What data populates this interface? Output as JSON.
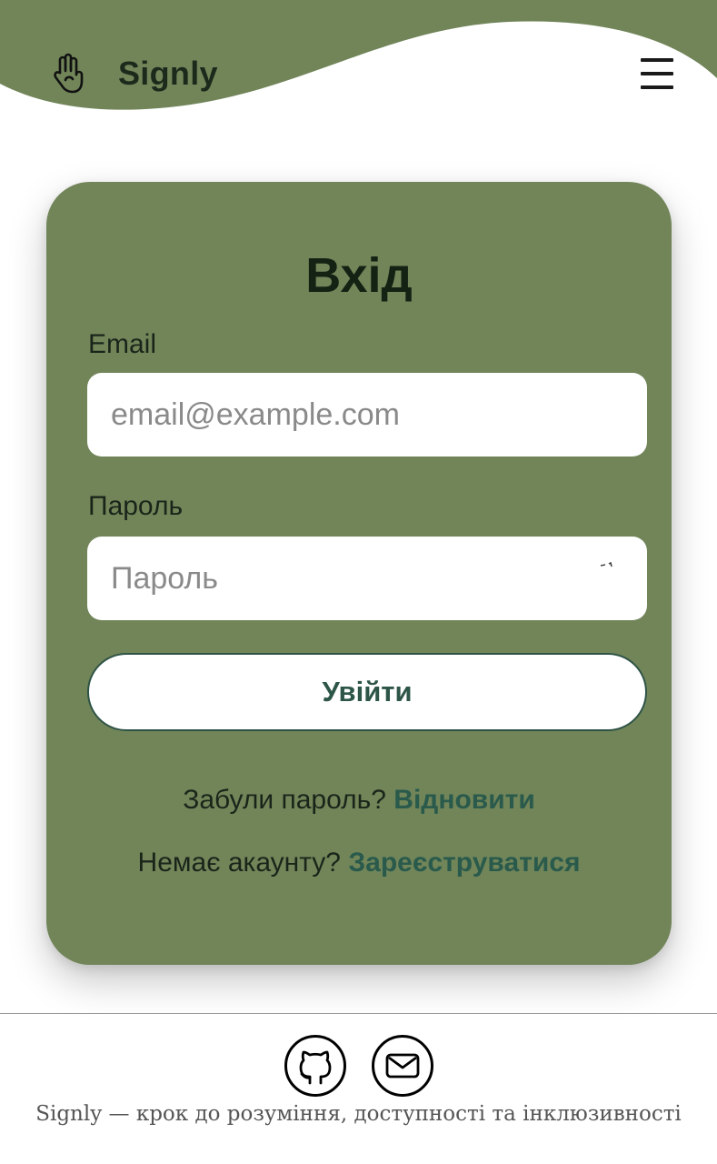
{
  "header": {
    "brand": "Signly",
    "accent_color": "#718559"
  },
  "login": {
    "title": "Вхід",
    "email_label": "Email",
    "email_placeholder": "email@example.com",
    "password_label": "Пароль",
    "password_placeholder": "Пароль",
    "submit_label": "Увійти",
    "forgot_text": "Забули пароль?",
    "forgot_link": "Відновити",
    "register_text": "Немає акаунту?",
    "register_link": "Зареєструватися"
  },
  "footer": {
    "tagline": "Signly — крок до розуміння, доступності та інклюзивності",
    "icons": [
      "github-icon",
      "mail-icon"
    ]
  }
}
